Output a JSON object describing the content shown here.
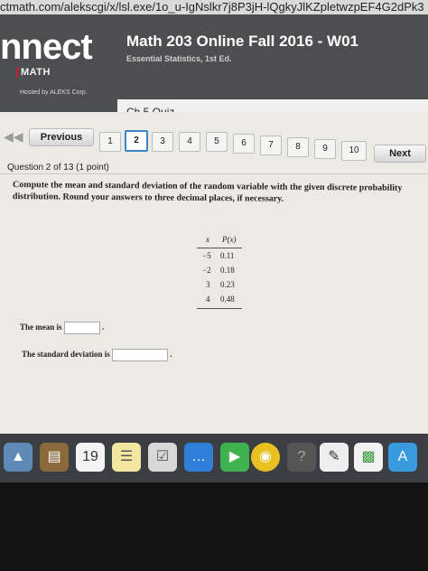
{
  "browser": {
    "url": "ctmath.com/alekscgi/x/lsl.exe/1o_u-IgNslkr7j8P3jH-lQgkyJlKZpletwzpEF4G2dPk3"
  },
  "header": {
    "logo_text": "nnect",
    "logo_sub": "MATH",
    "hosted_by": "Hosted by ALEKS Corp.",
    "course_title": "Math 203 Online Fall 2016 - W01",
    "course_subtitle": "Essential Statistics, 1st Ed.",
    "quiz_tab": "Ch 5 Quiz"
  },
  "nav": {
    "previous_label": "Previous",
    "next_label": "Next",
    "pages": [
      "1",
      "2",
      "3",
      "4",
      "5",
      "6",
      "7",
      "8",
      "9",
      "10"
    ],
    "active_page": "2"
  },
  "question": {
    "header": "Question 2 of 13 (1 point)",
    "instructions": "Compute the mean and standard deviation of the random variable with the given discrete probability distribution. Round your answers to three decimal places, if necessary.",
    "table": {
      "col_x": "x",
      "col_p": "P(x)",
      "rows": [
        {
          "x": "−5",
          "p": "0.11"
        },
        {
          "x": "−2",
          "p": "0.18"
        },
        {
          "x": "3",
          "p": "0.23"
        },
        {
          "x": "4",
          "p": "0.48"
        }
      ]
    },
    "mean_label": "The mean is",
    "sd_label": "The standard deviation is",
    "mean_value": "",
    "sd_value": "",
    "period": "."
  },
  "dock": {
    "calendar_day": "19"
  }
}
